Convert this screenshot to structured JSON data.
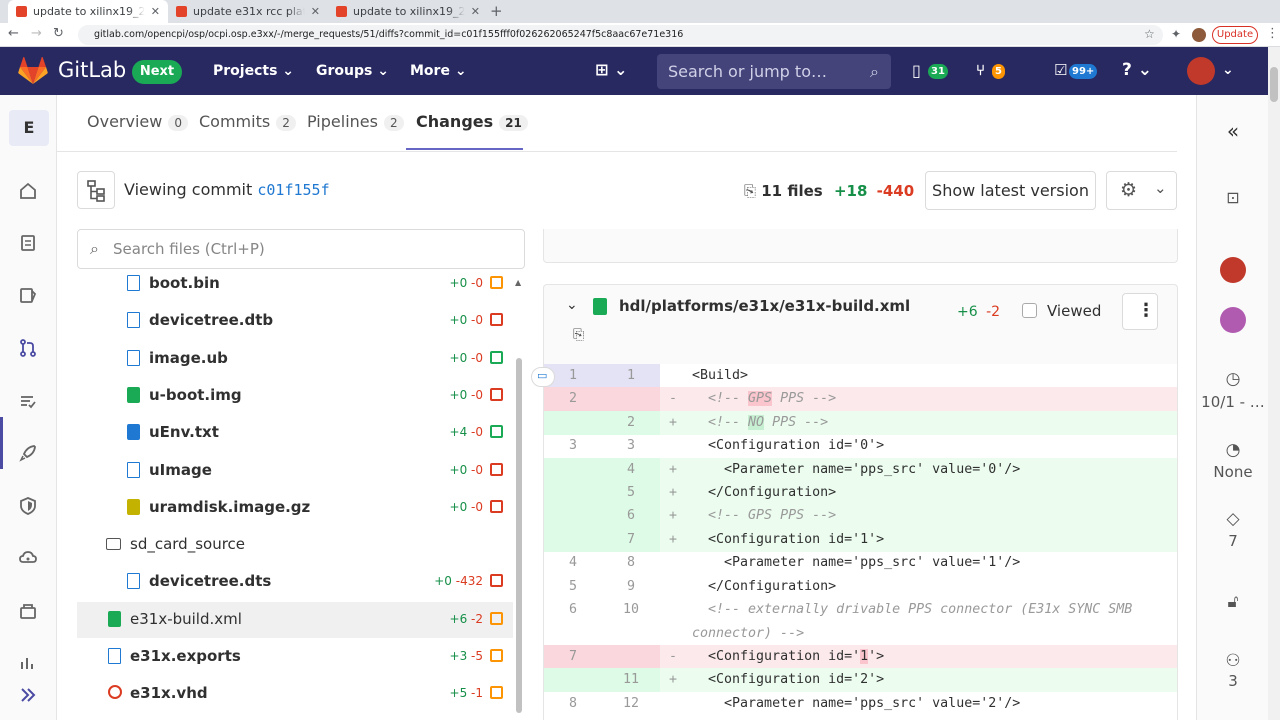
{
  "browser": {
    "tabs": [
      {
        "title": "update to xilinx19_2_aar",
        "close": "✕"
      },
      {
        "title": "update e31x rcc platform",
        "close": "✕"
      },
      {
        "title": "update to xilinx19_2_aar",
        "close": "✕"
      }
    ],
    "new_tab": "+",
    "url": "gitlab.com/opencpi/osp/ocpi.osp.e3xx/-/merge_requests/51/diffs?commit_id=c01f155fff0f026262065247f5c8aac67e71e316",
    "update_label": "Update"
  },
  "header": {
    "brand": "GitLab",
    "next_badge": "Next",
    "nav": [
      "Projects",
      "Groups",
      "More"
    ],
    "search_placeholder": "Search or jump to…",
    "issues_count": "31",
    "mr_count": "5",
    "todo_count": "99+"
  },
  "leftnav": {
    "project_letter": "E"
  },
  "mr_tabs": [
    {
      "label": "Overview",
      "count": "0"
    },
    {
      "label": "Commits",
      "count": "2"
    },
    {
      "label": "Pipelines",
      "count": "2"
    },
    {
      "label": "Changes",
      "count": "21"
    }
  ],
  "commit_bar": {
    "viewing_label": "Viewing commit",
    "sha": "c01f155f",
    "files": "11 files",
    "additions": "+18",
    "deletions": "-440",
    "show_latest": "Show latest version"
  },
  "file_tree": {
    "search_placeholder": "Search files (Ctrl+P)",
    "rows": [
      {
        "name": "boot.bin",
        "add": "+0",
        "del": "-0",
        "bold": true,
        "indent": 2,
        "type": "file",
        "badge": "modified"
      },
      {
        "name": "devicetree.dtb",
        "add": "+0",
        "del": "-0",
        "bold": true,
        "indent": 2,
        "type": "file",
        "badge": "deleted"
      },
      {
        "name": "image.ub",
        "add": "+0",
        "del": "-0",
        "bold": true,
        "indent": 2,
        "type": "file",
        "badge": "added"
      },
      {
        "name": "u-boot.img",
        "add": "+0",
        "del": "-0",
        "bold": true,
        "indent": 2,
        "type": "image",
        "badge": "deleted"
      },
      {
        "name": "uEnv.txt",
        "add": "+4",
        "del": "-0",
        "bold": true,
        "indent": 2,
        "type": "text",
        "badge": "added"
      },
      {
        "name": "uImage",
        "add": "+0",
        "del": "-0",
        "bold": true,
        "indent": 2,
        "type": "file",
        "badge": "deleted"
      },
      {
        "name": "uramdisk.image.gz",
        "add": "+0",
        "del": "-0",
        "bold": true,
        "indent": 2,
        "type": "archive",
        "badge": "deleted"
      },
      {
        "name": "sd_card_source",
        "add": "",
        "del": "",
        "bold": false,
        "indent": 1,
        "type": "folder",
        "badge": ""
      },
      {
        "name": "devicetree.dts",
        "add": "+0",
        "del": "-432",
        "bold": true,
        "indent": 2,
        "type": "file",
        "badge": "deleted"
      },
      {
        "name": "e31x-build.xml",
        "add": "+6",
        "del": "-2",
        "bold": false,
        "indent": 1,
        "type": "xml",
        "badge": "modified",
        "selected": true
      },
      {
        "name": "e31x.exports",
        "add": "+3",
        "del": "-5",
        "bold": true,
        "indent": 1,
        "type": "file",
        "badge": "modified"
      },
      {
        "name": "e31x.vhd",
        "add": "+5",
        "del": "-1",
        "bold": true,
        "indent": 1,
        "type": "vhd",
        "badge": "modified"
      }
    ]
  },
  "diff_file": {
    "path": "hdl/platforms/e31x/e31x-build.xml",
    "additions": "+6",
    "deletions": "-2",
    "viewed_label": "Viewed"
  },
  "diff_lines": [
    {
      "old": "1",
      "new": "1",
      "type": "ctx",
      "sign": "",
      "html": "&lt;Build&gt;"
    },
    {
      "old": "2",
      "new": "",
      "type": "old",
      "sign": "-",
      "html": "  <span class=\"cm\">&lt;!-- <span class=\"wdel\">GPS</span> PPS --&gt;</span>"
    },
    {
      "old": "",
      "new": "2",
      "type": "new",
      "sign": "+",
      "html": "  <span class=\"cm\">&lt;!-- <span class=\"wadd\">NO</span> PPS --&gt;</span>"
    },
    {
      "old": "3",
      "new": "3",
      "type": "ctx",
      "sign": "",
      "html": "  &lt;Configuration id='0'&gt;"
    },
    {
      "old": "",
      "new": "4",
      "type": "new",
      "sign": "+",
      "html": "    &lt;Parameter name='pps_src' value='0'/&gt;"
    },
    {
      "old": "",
      "new": "5",
      "type": "new",
      "sign": "+",
      "html": "  &lt;/Configuration&gt;"
    },
    {
      "old": "",
      "new": "6",
      "type": "new",
      "sign": "+",
      "html": "  <span class=\"cm\">&lt;!-- GPS PPS --&gt;</span>"
    },
    {
      "old": "",
      "new": "7",
      "type": "new",
      "sign": "+",
      "html": "  &lt;Configuration id='1'&gt;"
    },
    {
      "old": "4",
      "new": "8",
      "type": "ctx",
      "sign": "",
      "html": "    &lt;Parameter name='pps_src' value='1'/&gt;"
    },
    {
      "old": "5",
      "new": "9",
      "type": "ctx",
      "sign": "",
      "html": "  &lt;/Configuration&gt;"
    },
    {
      "old": "6",
      "new": "10",
      "type": "ctx",
      "sign": "",
      "tall": true,
      "html": "  <span class=\"cm\">&lt;!-- externally drivable PPS connector (E31x SYNC SMB connector) --&gt;</span>"
    },
    {
      "old": "7",
      "new": "",
      "type": "old",
      "sign": "-",
      "html": "  &lt;Configuration id='<span class=\"wdel\">1</span>'&gt;"
    },
    {
      "old": "",
      "new": "11",
      "type": "new",
      "sign": "+",
      "html": "  &lt;Configuration id='2'&gt;"
    },
    {
      "old": "8",
      "new": "12",
      "type": "ctx",
      "sign": "",
      "html": "    &lt;Parameter name='pps_src' value='2'/&gt;"
    }
  ],
  "right_sidebar": {
    "date": "10/1 - …",
    "time_estimate": "None",
    "labels_count": "7",
    "participants_count": "3"
  },
  "colors": {
    "header_bg": "#292961",
    "next_green": "#1aaa55",
    "link_blue": "#1f78d1",
    "addition_green": "#168f48",
    "deletion_red": "#db3b21",
    "active_tab_underline": "#6666c4"
  }
}
